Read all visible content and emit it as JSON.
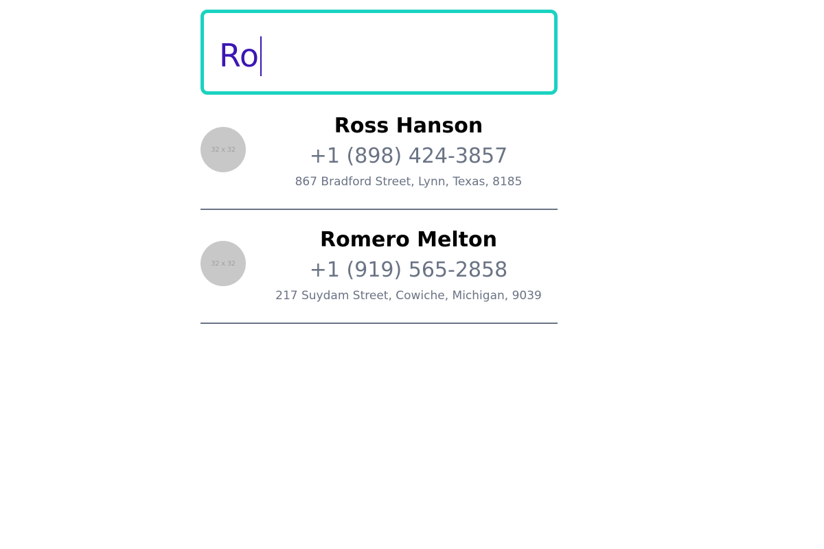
{
  "search": {
    "value": "Ro"
  },
  "colors": {
    "search_border": "#1ad3c1",
    "search_text": "#3b16b3",
    "divider": "#6b7285",
    "secondary_text": "#6a7384",
    "avatar_bg": "#c8c8c8"
  },
  "contacts": [
    {
      "avatar_text": "32 x 32",
      "name": "Ross Hanson",
      "phone": "+1 (898) 424-3857",
      "address": "867 Bradford Street, Lynn, Texas, 8185"
    },
    {
      "avatar_text": "32 x 32",
      "name": "Romero Melton",
      "phone": "+1 (919) 565-2858",
      "address": "217 Suydam Street, Cowiche, Michigan, 9039"
    }
  ]
}
